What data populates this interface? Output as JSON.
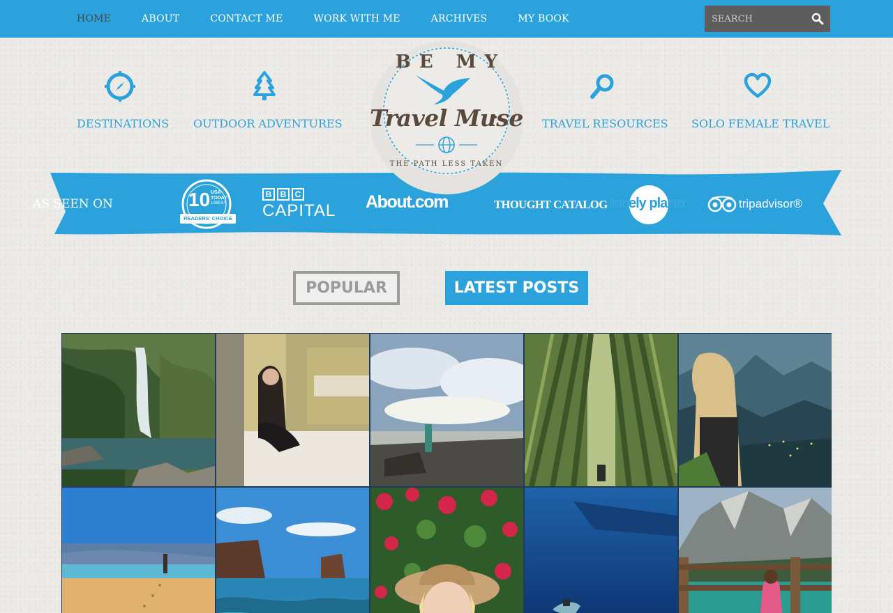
{
  "nav": {
    "items": [
      {
        "label": "HOME",
        "active": true
      },
      {
        "label": "ABOUT"
      },
      {
        "label": "CONTACT ME"
      },
      {
        "label": "WORK WITH ME"
      },
      {
        "label": "ARCHIVES"
      },
      {
        "label": "MY BOOK"
      }
    ],
    "search_placeholder": "SEARCH",
    "search_icon": "magnifier-icon"
  },
  "categories": {
    "destinations": {
      "label": "DESTINATIONS",
      "icon": "compass-icon"
    },
    "outdoor": {
      "label": "OUTDOOR ADVENTURES",
      "icon": "tree-icon"
    },
    "resources": {
      "label": "TRAVEL RESOURCES",
      "icon": "magnifier-icon"
    },
    "solo": {
      "label": "SOLO FEMALE TRAVEL",
      "icon": "heart-icon"
    }
  },
  "logo": {
    "top": "BE MY",
    "main": "Travel Muse",
    "tagline": "THE PATH LESS TAKEN"
  },
  "press": {
    "label": "AS SEEN ON",
    "usatoday_top": "USA TODAY",
    "usatoday_sub": "10BEST",
    "usatoday_num": "10",
    "usatoday_badge": "READERS' CHOICE",
    "bbc": "BBC",
    "bbc_sub": "CAPITAL",
    "about": "About.com",
    "thought": "THOUGHT CATALOG",
    "lonely": "lonely planet",
    "tripadvisor": "tripadvisor®"
  },
  "tabs": {
    "popular": "POPULAR",
    "latest": "LATEST POSTS"
  },
  "colors": {
    "brand_blue": "#2ba2db",
    "nav_active": "#4a4a4a",
    "logo_brown": "#5a4a3e"
  },
  "thumbnails": [
    "waterfall",
    "hotel-room",
    "beach-shore",
    "bamboo-forest",
    "mountain-view",
    "sandy-beach",
    "sea-cliffs",
    "flowers-hat",
    "underwater-swim",
    "alpine-lake"
  ]
}
